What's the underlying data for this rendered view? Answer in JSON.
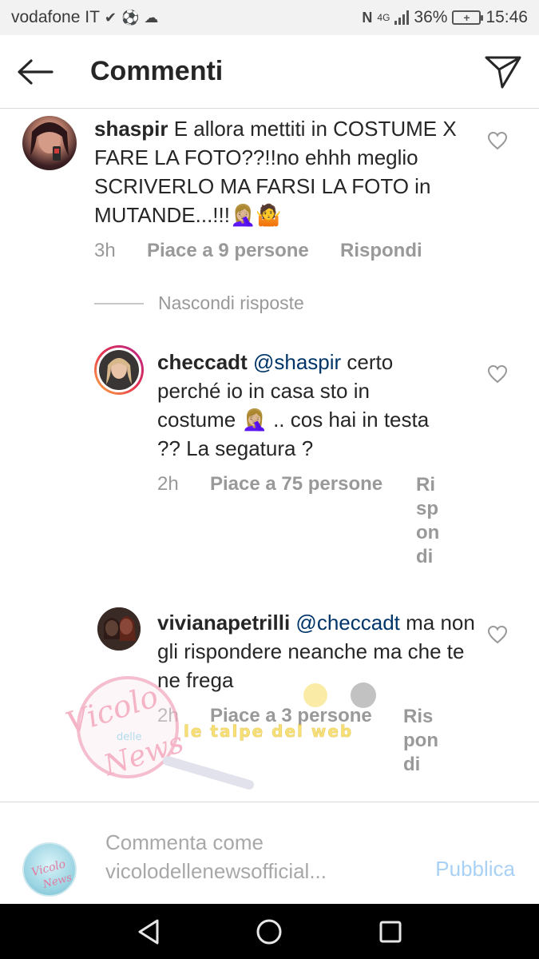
{
  "status_bar": {
    "carrier": "vodafone IT",
    "network": "4G",
    "battery": "36%",
    "time": "15:46"
  },
  "header": {
    "title": "Commenti"
  },
  "comments": [
    {
      "username": "shaspir",
      "text": "E allora mettiti in COSTUME X FARE LA FOTO??!!no ehhh meglio SCRIVERLO MA FARSI LA FOTO in MUTANDE...!!!🤦🏼‍♀️🤷",
      "time": "3h",
      "likes": "Piace a 9 persone",
      "reply": "Rispondi"
    }
  ],
  "hide_replies": "Nascondi risposte",
  "replies": [
    {
      "username": "checcadt",
      "mention": "@shaspir",
      "text": "certo perché io in casa sto in costume 🤦🏼‍♀️ .. cos hai in testa ?? La segatura ?",
      "time": "2h",
      "likes": "Piace a 75 persone",
      "reply": "Rispondi"
    },
    {
      "username": "vivianapetrilli",
      "mention": "@checcadt",
      "text": "ma non gli rispondere neanche ma che te ne frega",
      "time": "2h",
      "likes": "Piace a 3 persone",
      "reply": "Rispondi"
    }
  ],
  "watermark": {
    "line1": "Vicolo",
    "line2": "delle",
    "line3": "News",
    "banner": "le talpe del web"
  },
  "input": {
    "placeholder": "Commenta come vicolodellenewsofficial...",
    "publish": "Pubblica"
  },
  "colors": {
    "mention": "#003569",
    "meta": "#999999",
    "publish_disabled": "#a8d1f5"
  }
}
